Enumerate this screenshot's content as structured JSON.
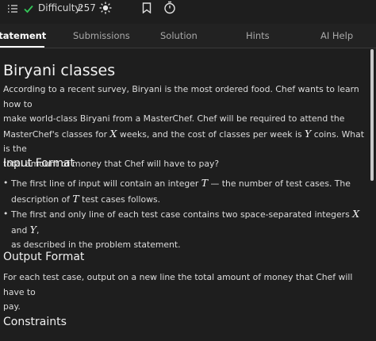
{
  "topbar": {
    "difficulty_label": "Difficulty:",
    "difficulty_value": "257",
    "icons": [
      "list-icon",
      "check-icon",
      "sun-icon",
      "bookmark-icon",
      "timer-icon"
    ]
  },
  "tabs": [
    {
      "label": "Statement",
      "active": true
    },
    {
      "label": "Submissions",
      "active": false
    },
    {
      "label": "Solution",
      "active": false
    },
    {
      "label": "Hints",
      "active": false
    },
    {
      "label": "AI Help",
      "active": false
    }
  ],
  "problem": {
    "title": "Biryani classes",
    "statement": {
      "line1": "According to a recent survey, Biryani is the most ordered food. Chef wants to learn how to",
      "line2": "make world-class Biryani from a MasterChef. Chef will be required to attend the",
      "line3_a": "MasterChef's classes for",
      "var_x": "X",
      "line3_b": "weeks, and the cost of classes per week is",
      "var_y": "Y",
      "line3_c": "coins. What is the",
      "line4": "total amount of money that Chef will have to pay?"
    },
    "input_format": {
      "heading": "Input Format",
      "b1_a": "The first line of input will contain an integer",
      "var_t": "T",
      "b1_b": "— the number of test cases. The",
      "b1_c": "description of",
      "var_t2": "T",
      "b1_d": "test cases follows.",
      "b2_a": "The first and only line of each test case contains two space-separated integers",
      "var_x": "X",
      "b2_and": "and",
      "var_y": "Y",
      "b2_comma": ",",
      "b2_b": "as described in the problem statement."
    },
    "output_format": {
      "heading": "Output Format",
      "line1": "For each test case, output on a new line the total amount of money that Chef will have to",
      "line2": "pay."
    },
    "constraints": {
      "heading": "Constraints"
    }
  },
  "colors": {
    "background": "#1e1e1e",
    "tab_bar": "#222222",
    "check": "#34c759",
    "active_tab": "#ffffff"
  }
}
